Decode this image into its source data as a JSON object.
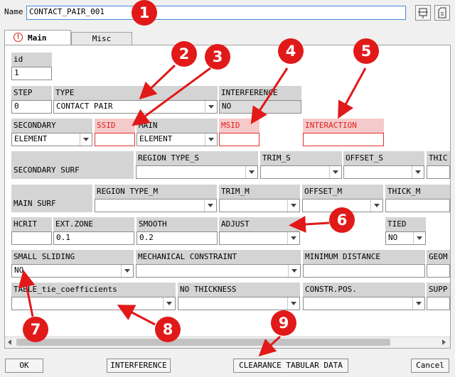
{
  "name_label": "Name",
  "name_value": "CONTACT_PAIR_001",
  "tabs": [
    {
      "label": "Main"
    },
    {
      "label": "Misc"
    }
  ],
  "fields": {
    "id": {
      "label": "id",
      "value": "1"
    },
    "step": {
      "label": "STEP",
      "value": "0"
    },
    "type": {
      "label": "TYPE",
      "value": "CONTACT PAIR"
    },
    "interference": {
      "label": "INTERFERENCE",
      "value": "NO"
    },
    "secondary": {
      "label": "SECONDARY",
      "value": "ELEMENT"
    },
    "ssid": {
      "label": "SSID",
      "value": ""
    },
    "main": {
      "label": "MAIN",
      "value": "ELEMENT"
    },
    "msid": {
      "label": "MSID",
      "value": ""
    },
    "interaction": {
      "label": "INTERACTION",
      "value": ""
    },
    "secondary_surf": {
      "label": "SECONDARY SURF"
    },
    "region_type_s": {
      "label": "REGION TYPE_S"
    },
    "trim_s": {
      "label": "TRIM_S"
    },
    "offset_s": {
      "label": "OFFSET_S"
    },
    "thick_s": {
      "label": "THIC"
    },
    "main_surf": {
      "label": "MAIN SURF"
    },
    "region_type_m": {
      "label": "REGION TYPE_M"
    },
    "trim_m": {
      "label": "TRIM_M"
    },
    "offset_m": {
      "label": "OFFSET_M"
    },
    "thick_m": {
      "label": "THICK_M"
    },
    "hcrit": {
      "label": "HCRIT",
      "value": ""
    },
    "ext_zone": {
      "label": "EXT.ZONE",
      "value": "0.1"
    },
    "smooth": {
      "label": "SMOOTH",
      "value": "0.2"
    },
    "adjust": {
      "label": "ADJUST",
      "value": ""
    },
    "tied": {
      "label": "TIED",
      "value": "NO"
    },
    "small_sliding": {
      "label": "SMALL SLIDING",
      "value": "NO"
    },
    "mech_constraint": {
      "label": "MECHANICAL CONSTRAINT"
    },
    "min_distance": {
      "label": "MINIMUM DISTANCE"
    },
    "geom": {
      "label": "GEOM"
    },
    "table_tie": {
      "label": "TABLE_tie_coefficients"
    },
    "no_thickness": {
      "label": "NO THICKNESS"
    },
    "constr_pos": {
      "label": "CONSTR.POS."
    },
    "supp": {
      "label": "SUPP"
    }
  },
  "buttons": {
    "ok": "OK",
    "interference": "INTERFERENCE",
    "clearance": "CLEARANCE TABULAR DATA",
    "cancel": "Cancel"
  },
  "callouts": [
    "1",
    "2",
    "3",
    "4",
    "5",
    "6",
    "7",
    "8",
    "9"
  ],
  "colors": {
    "callout": "#e11919",
    "error_label_bg": "#f5caca",
    "error_text": "#e02020"
  },
  "icons": [
    "error-icon",
    "pin-icon",
    "save-icon",
    "dropdown-arrow-icon",
    "scroll-left-icon",
    "scroll-right-icon"
  ]
}
